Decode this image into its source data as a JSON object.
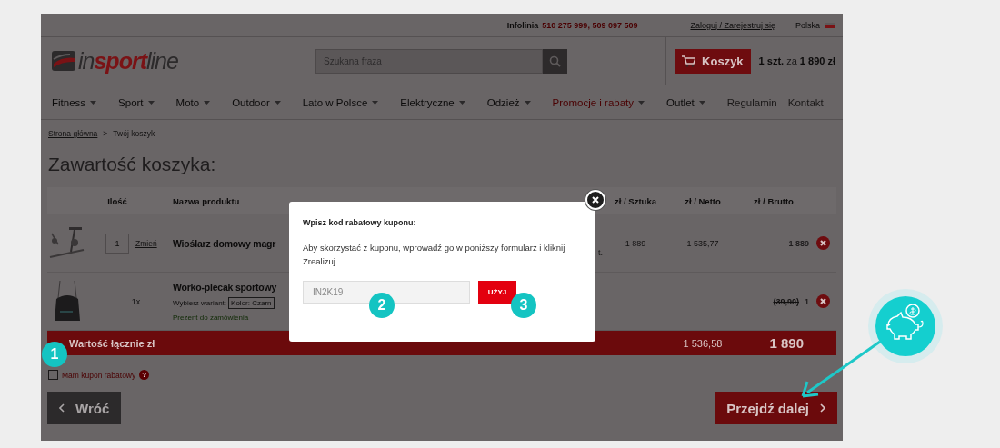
{
  "top_bar": {
    "hotline_label": "Infolinia",
    "hotline_numbers": "510 275 999, 509 097 509",
    "login": "Zaloguj / Zarejestruj się",
    "language": "Polska"
  },
  "header": {
    "logo": "in**sport**line",
    "search": {
      "placeholder": "Szukana fraza"
    },
    "cart_button": "Koszyk",
    "cart_summary": "**1 szt.** za **1 890 zł**"
  },
  "nav": [
    {
      "label": "Fitness",
      "has_menu": true,
      "highlighted": false
    },
    {
      "label": "Sport",
      "has_menu": true,
      "highlighted": false
    },
    {
      "label": "Moto",
      "has_menu": true,
      "highlighted": false
    },
    {
      "label": "Outdoor",
      "has_menu": true,
      "highlighted": false
    },
    {
      "label": "Lato w Polsce",
      "has_menu": true,
      "highlighted": false
    },
    {
      "label": "Elektryczne",
      "has_menu": true,
      "highlighted": false
    },
    {
      "label": "Odzież",
      "has_menu": true,
      "highlighted": false
    },
    {
      "label": "Promocje i rabaty",
      "has_menu": true,
      "highlighted": true
    },
    {
      "label": "Outlet",
      "has_menu": true,
      "highlighted": false
    },
    {
      "label": "Regulamin",
      "has_menu": false,
      "highlighted": false
    },
    {
      "label": "Kontakt",
      "has_menu": false,
      "highlighted": false
    }
  ],
  "breadcrumb": [
    {
      "label": "Strona główna",
      "link": true
    },
    {
      "label": ">",
      "link": false
    },
    {
      "label": "Twój koszyk",
      "link": false
    }
  ],
  "heading": "Zawartość koszyka:",
  "table": {
    "columns": {
      "quantity": "Ilość",
      "name": "Nazwa produktu",
      "unit": "zł / Sztuka",
      "net": "zł / Netto",
      "gross": "zł / Brutto"
    },
    "rows": [
      {
        "kind": "product",
        "quantity": "1",
        "change": "Zmień",
        "name": "Wioślarz domowy magr",
        "unit_fragment": "t.",
        "unit": "1 889",
        "net": "1 535,77",
        "gross": "1 889"
      },
      {
        "kind": "gift",
        "quantity": "1x",
        "name": "Worko-plecak sportowy",
        "variant_label": "Wybierz wariant:",
        "variant": "Kolor: Czarn",
        "note": "Prezent do zamówienia",
        "old_price": "(39,90)",
        "gross": "1"
      }
    ],
    "total": {
      "label": "Wartość łącznie zł",
      "net": "1 536,58",
      "gross": "1 890"
    }
  },
  "coupon": {
    "label": "Mam kupon rabatowy",
    "checked": false,
    "help": "?"
  },
  "back_button": "Wróć",
  "next_button": "Przejdź dalej",
  "modal": {
    "title": "Wpisz kod rabatowy kuponu:",
    "text": "Aby skorzystać z kuponu, wprowadź go w poniższy formularz i kliknij Zrealizuj.",
    "code": "IN2K19",
    "apply_button": "UŻYJ"
  },
  "steps": [
    "1",
    "2",
    "3"
  ]
}
